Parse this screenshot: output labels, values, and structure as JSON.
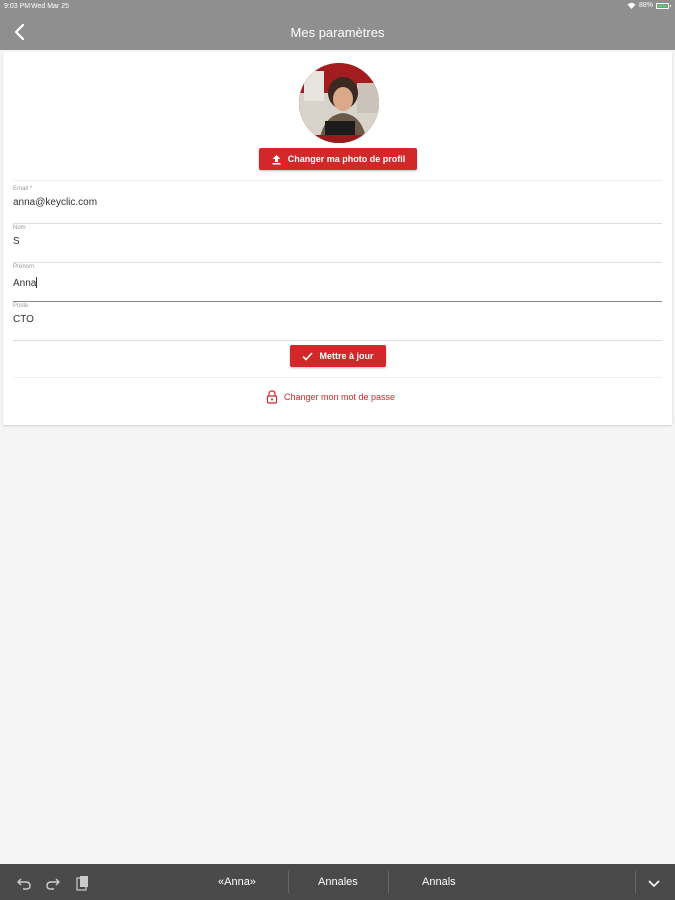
{
  "status_bar": {
    "time": "9:03 PM",
    "date": "Wed Mar 25",
    "battery": "88%"
  },
  "nav": {
    "title": "Mes paramètres"
  },
  "profile": {
    "change_photo_label": "Changer ma photo de profil"
  },
  "form": {
    "email": {
      "label": "Email *",
      "value": "anna@keyclic.com"
    },
    "nom": {
      "label": "Nom",
      "value": "S"
    },
    "prenom": {
      "label": "Prénom",
      "value": "Anna"
    },
    "poste": {
      "label": "Poste",
      "value": "CTO"
    },
    "update_label": "Mettre à jour"
  },
  "change_password_label": "Changer mon mot de passe",
  "keyboard": {
    "suggestions": [
      "«Anna»",
      "Annales",
      "Annals"
    ]
  },
  "colors": {
    "accent": "#d2282a",
    "nav_bg": "#8f8f8f",
    "keyboard_bg": "#4a4a4a"
  }
}
